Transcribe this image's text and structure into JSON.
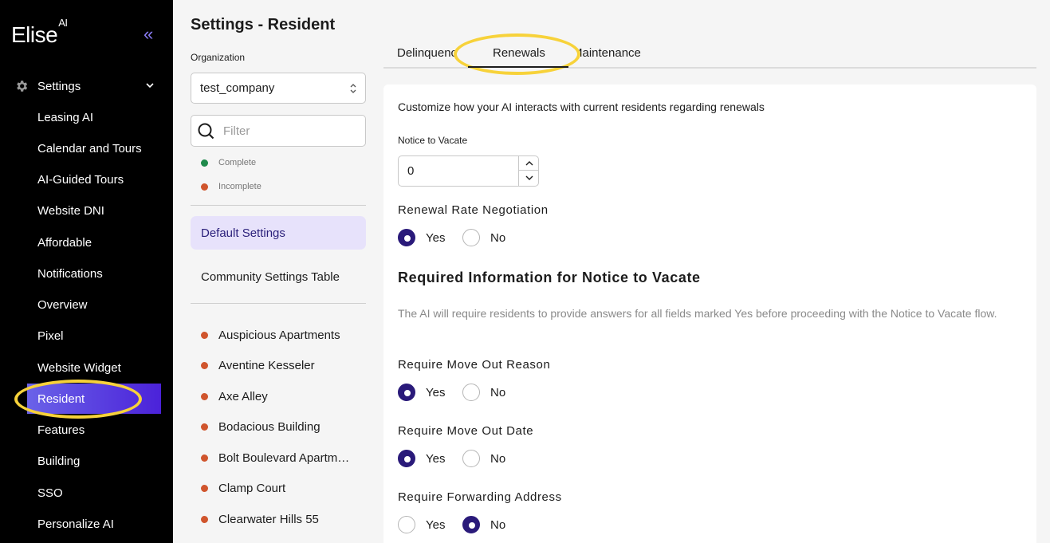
{
  "sidebar": {
    "logo_text": "Elise",
    "logo_sup": "AI",
    "collapse_glyph": "«",
    "section_label": "Settings",
    "items": [
      {
        "label": "Leasing AI"
      },
      {
        "label": "Calendar and Tours"
      },
      {
        "label": "AI-Guided Tours"
      },
      {
        "label": "Website DNI"
      },
      {
        "label": "Affordable"
      },
      {
        "label": "Notifications"
      },
      {
        "label": "Overview"
      },
      {
        "label": "Pixel"
      },
      {
        "label": "Website Widget"
      },
      {
        "label": "Resident",
        "active": true
      },
      {
        "label": "Features"
      },
      {
        "label": "Building"
      },
      {
        "label": "SSO"
      },
      {
        "label": "Personalize AI"
      }
    ],
    "active_gradient": [
      "#6a62e8",
      "#4b22d9"
    ]
  },
  "page": {
    "title": "Settings - Resident"
  },
  "org": {
    "label": "Organization",
    "value": "test_company"
  },
  "filter": {
    "placeholder": "Filter"
  },
  "legend": {
    "complete": "Complete",
    "incomplete": "Incomplete",
    "complete_color": "#1f8a4c",
    "incomplete_color": "#d0552d"
  },
  "settings_nav": {
    "default": "Default Settings",
    "community_table": "Community Settings Table"
  },
  "communities": [
    {
      "name": "Auspicious Apartments",
      "status": "incomplete"
    },
    {
      "name": "Aventine Kesseler",
      "status": "incomplete"
    },
    {
      "name": "Axe Alley",
      "status": "incomplete"
    },
    {
      "name": "Bodacious Building",
      "status": "incomplete"
    },
    {
      "name": "Bolt Boulevard Apartme...",
      "status": "incomplete"
    },
    {
      "name": "Clamp Court",
      "status": "incomplete"
    },
    {
      "name": "Clearwater Hills 55",
      "status": "incomplete"
    }
  ],
  "tabs": [
    {
      "label": "Delinquency"
    },
    {
      "label": "Renewals",
      "active": true
    },
    {
      "label": "Maintenance"
    }
  ],
  "content": {
    "description": "Customize how your AI interacts with current residents regarding renewals",
    "notice_label": "Notice to Vacate",
    "notice_value": "0",
    "renewal_negotiation": {
      "title": "Renewal Rate Negotiation",
      "selected": "Yes"
    },
    "required_section_title": "Required Information for Notice to Vacate",
    "required_helper": "The AI will require residents to provide answers for all fields marked Yes before proceeding with the Notice to Vacate flow.",
    "questions": [
      {
        "title": "Require Move Out Reason",
        "selected": "Yes"
      },
      {
        "title": "Require Move Out Date",
        "selected": "Yes"
      },
      {
        "title": "Require Forwarding Address",
        "selected": "No"
      }
    ],
    "yes_label": "Yes",
    "no_label": "No"
  },
  "highlight_color": "#f7d23a",
  "accent_color": "#2a1a7a"
}
